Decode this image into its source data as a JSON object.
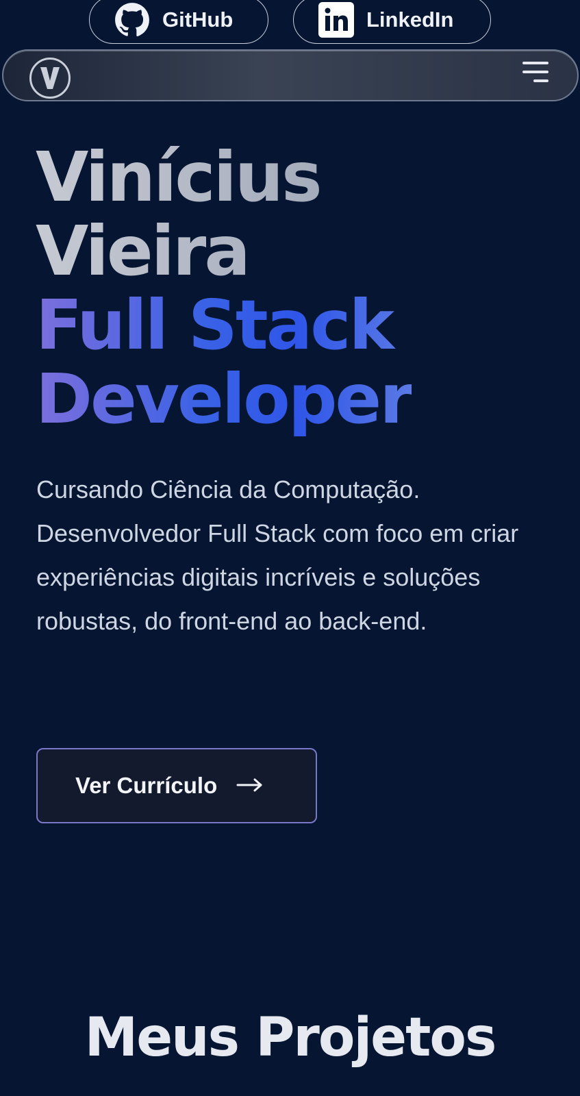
{
  "social": {
    "github_label": "GitHub",
    "linkedin_label": "LinkedIn",
    "linkedin_icon_text": "in"
  },
  "navbar": {
    "logo_letter": "V"
  },
  "hero": {
    "name_line1": "Vinícius",
    "name_line2": "Vieira",
    "role_line1": "Full Stack",
    "role_line2": "Developer",
    "description": "Cursando Ciência da Computação. Desenvolvedor Full Stack com foco em criar experiências digitais incríveis e soluções robustas, do front-end ao back-end.",
    "cta_label": "Ver Currículo",
    "cta_arrow": "→"
  },
  "projects": {
    "title": "Meus Projetos"
  },
  "colors": {
    "background": "#061632",
    "accent_blue": "#2f56e8",
    "accent_violet": "#7c6fdc",
    "text_light": "#cfd6e3"
  },
  "icons": [
    "github-icon",
    "linkedin-icon",
    "logo-icon",
    "hamburger-menu-icon",
    "arrow-right-icon"
  ]
}
